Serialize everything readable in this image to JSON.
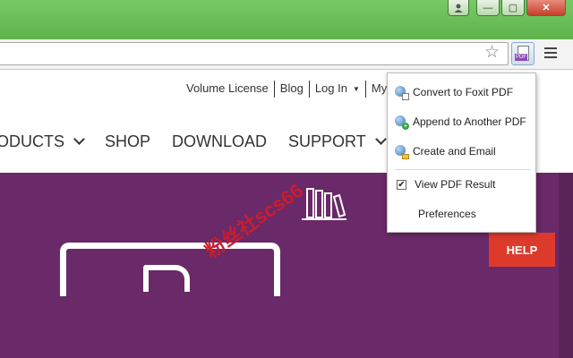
{
  "window": {
    "user_icon": "person-icon",
    "minimize_glyph": "—",
    "maximize_glyph": "▢",
    "close_glyph": "✕"
  },
  "toolbar": {
    "star_glyph": "☆",
    "pdf_tag": "PDF"
  },
  "site": {
    "top_links": [
      "Volume License",
      "Blog",
      "Log In",
      "My"
    ],
    "nav": [
      "ODUCTS",
      "SHOP",
      "DOWNLOAD",
      "SUPPORT"
    ],
    "help_label": "HELP",
    "watermark": "粉丝社scs66"
  },
  "menu": {
    "items": [
      {
        "label": "Convert to Foxit PDF",
        "icon": "globe-doc-icon"
      },
      {
        "label": "Append to Another PDF",
        "icon": "globe-plus-icon"
      },
      {
        "label": "Create and Email",
        "icon": "globe-mail-icon"
      }
    ],
    "view_result_label": "View PDF Result",
    "view_result_checked": true,
    "preferences_label": "Preferences"
  },
  "colors": {
    "titlebar": "#6fc15d",
    "hero": "#6a2968",
    "help": "#de3a2c",
    "watermark": "#c81d2e"
  }
}
